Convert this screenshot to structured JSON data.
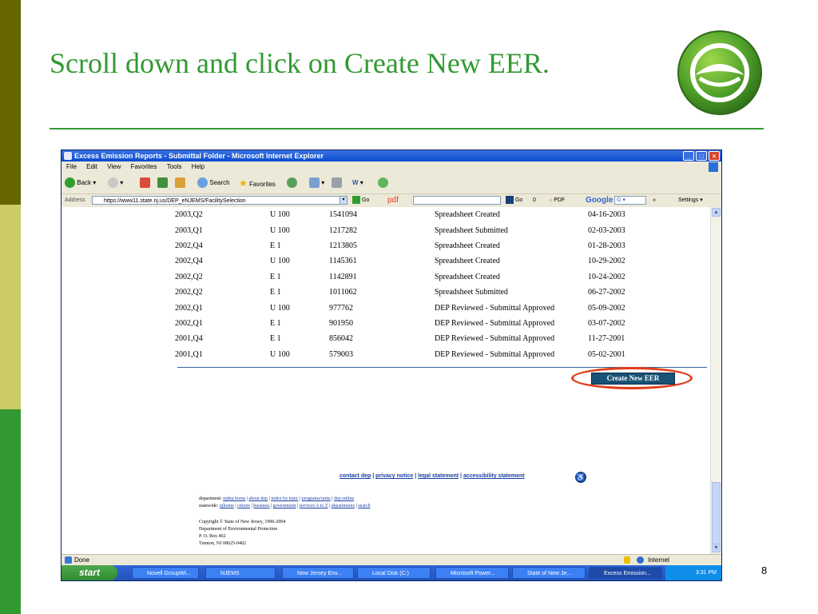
{
  "slide": {
    "title": "Scroll down and click on Create New EER.",
    "page_number": "8",
    "colors": {
      "accent": "#339933",
      "sidebar_dark": "#666600",
      "sidebar_light": "#cccc66"
    }
  },
  "browser": {
    "window_title": "Excess Emission Reports - Submittal Folder - Microsoft Internet Explorer",
    "menus": [
      "File",
      "Edit",
      "View",
      "Favorites",
      "Tools",
      "Help"
    ],
    "toolbar": {
      "back": "Back",
      "search": "Search",
      "favorites": "Favorites"
    },
    "address_label": "Address",
    "address_value": "https://www11.state.nj.us/DEP_eNJEMS/FacilitySelection",
    "go_label": "Go",
    "pdf_label": "pdf",
    "go2_label": "Go",
    "pdf_count": "0",
    "pdf2_label": "PDF",
    "google_label": "Google",
    "g_label": "G",
    "settings_label": "Settings",
    "status_text": "Done",
    "status_zone": "Internet"
  },
  "submittals": [
    {
      "period": "2003,Q2",
      "unit": "U 100",
      "id": "1541094",
      "status": "Spreadsheet Created",
      "date": "04-16-2003"
    },
    {
      "period": "2003,Q1",
      "unit": "U 100",
      "id": "1217282",
      "status": "Spreadsheet Submitted",
      "date": "02-03-2003"
    },
    {
      "period": "2002,Q4",
      "unit": "E 1",
      "id": "1213805",
      "status": "Spreadsheet Created",
      "date": "01-28-2003"
    },
    {
      "period": "2002,Q4",
      "unit": "U 100",
      "id": "1145361",
      "status": "Spreadsheet Created",
      "date": "10-29-2002"
    },
    {
      "period": "2002,Q2",
      "unit": "E 1",
      "id": "1142891",
      "status": "Spreadsheet Created",
      "date": "10-24-2002"
    },
    {
      "period": "2002,Q2",
      "unit": "E 1",
      "id": "1011062",
      "status": "Spreadsheet Submitted",
      "date": "06-27-2002"
    },
    {
      "period": "2002,Q1",
      "unit": "U 100",
      "id": "977762",
      "status": "DEP Reviewed - Submittal Approved",
      "date": "05-09-2002"
    },
    {
      "period": "2002,Q1",
      "unit": "E 1",
      "id": "901950",
      "status": "DEP Reviewed - Submittal Approved",
      "date": "03-07-2002"
    },
    {
      "period": "2001,Q4",
      "unit": "E 1",
      "id": "856042",
      "status": "DEP Reviewed - Submittal Approved",
      "date": "11-27-2001"
    },
    {
      "period": "2001,Q1",
      "unit": "U 100",
      "id": "579003",
      "status": "DEP Reviewed - Submittal Approved",
      "date": "05-02-2001"
    }
  ],
  "create_button_label": "Create New EER",
  "footer": {
    "contact": "contact dep",
    "privacy": "privacy notice",
    "legal": "legal statement",
    "accessibility": "accessibility statement",
    "separator": "|",
    "department_label": "department:",
    "department_links": [
      "njdep home",
      "about dep",
      "index by topic",
      "programs/units",
      "dep online"
    ],
    "statewide_label": "statewide:",
    "statewide_links": [
      "njhome",
      "citizen",
      "business",
      "government",
      "services A to Z",
      "departments",
      "search"
    ],
    "copyright": "Copyright © State of New Jersey, 1996-2004",
    "org": "Department of Environmental Protection",
    "pobox": "P. O. Box 402",
    "city": "Trenton, NJ 08625-0402"
  },
  "taskbar": {
    "start_label": "start",
    "tasks": [
      "Novell GroupWi...",
      "NJEMS",
      "New Jersey Env...",
      "Local Disk (C:)",
      "Microsoft Power...",
      "State of New Je...",
      "Excess Emission..."
    ],
    "clock": "3:31 PM"
  }
}
